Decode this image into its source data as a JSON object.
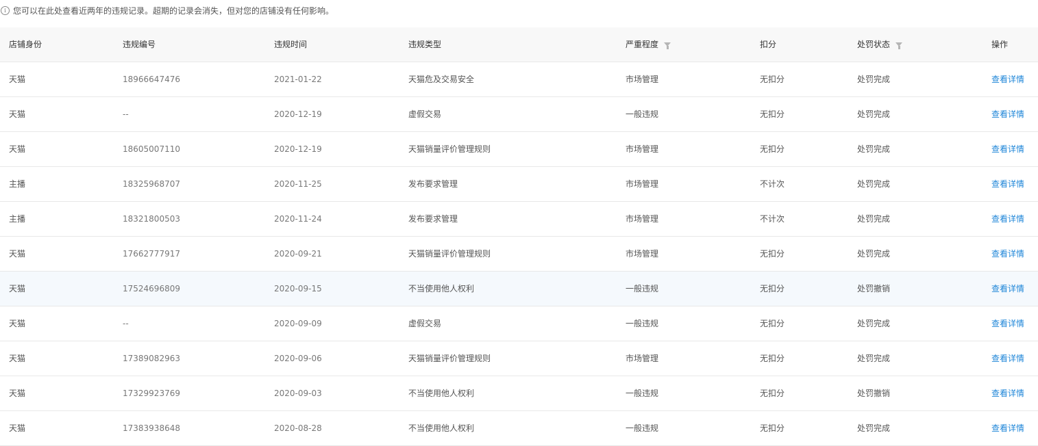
{
  "notice": {
    "icon": "info-icon",
    "icon_glyph": "i",
    "text": "您可以在此处查看近两年的违规记录。超期的记录会消失，但对您的店铺没有任何影响。"
  },
  "table": {
    "headers": [
      "店铺身份",
      "违规编号",
      "违规时间",
      "违规类型",
      "严重程度",
      "扣分",
      "处罚状态",
      "操作"
    ],
    "filterable_columns": [
      "严重程度",
      "处罚状态"
    ],
    "highlight_row_index": 6,
    "link_color": "#1f86d8",
    "rows": [
      {
        "identity": "天猫",
        "code": "18966647476",
        "time": "2021-01-22",
        "type": "天猫危及交易安全",
        "severity": "市场管理",
        "points": "无扣分",
        "status": "处罚完成",
        "action": "查看详情"
      },
      {
        "identity": "天猫",
        "code": "--",
        "time": "2020-12-19",
        "type": "虚假交易",
        "severity": "一般违规",
        "points": "无扣分",
        "status": "处罚完成",
        "action": "查看详情"
      },
      {
        "identity": "天猫",
        "code": "18605007110",
        "time": "2020-12-19",
        "type": "天猫销量评价管理规则",
        "severity": "市场管理",
        "points": "无扣分",
        "status": "处罚完成",
        "action": "查看详情"
      },
      {
        "identity": "主播",
        "code": "18325968707",
        "time": "2020-11-25",
        "type": "发布要求管理",
        "severity": "市场管理",
        "points": "不计次",
        "status": "处罚完成",
        "action": "查看详情"
      },
      {
        "identity": "主播",
        "code": "18321800503",
        "time": "2020-11-24",
        "type": "发布要求管理",
        "severity": "市场管理",
        "points": "不计次",
        "status": "处罚完成",
        "action": "查看详情"
      },
      {
        "identity": "天猫",
        "code": "17662777917",
        "time": "2020-09-21",
        "type": "天猫销量评价管理规则",
        "severity": "市场管理",
        "points": "无扣分",
        "status": "处罚完成",
        "action": "查看详情"
      },
      {
        "identity": "天猫",
        "code": "17524696809",
        "time": "2020-09-15",
        "type": "不当使用他人权利",
        "severity": "一般违规",
        "points": "无扣分",
        "status": "处罚撤销",
        "action": "查看详情"
      },
      {
        "identity": "天猫",
        "code": "--",
        "time": "2020-09-09",
        "type": "虚假交易",
        "severity": "一般违规",
        "points": "无扣分",
        "status": "处罚完成",
        "action": "查看详情"
      },
      {
        "identity": "天猫",
        "code": "17389082963",
        "time": "2020-09-06",
        "type": "天猫销量评价管理规则",
        "severity": "市场管理",
        "points": "无扣分",
        "status": "处罚完成",
        "action": "查看详情"
      },
      {
        "identity": "天猫",
        "code": "17329923769",
        "time": "2020-09-03",
        "type": "不当使用他人权利",
        "severity": "一般违规",
        "points": "无扣分",
        "status": "处罚撤销",
        "action": "查看详情"
      },
      {
        "identity": "天猫",
        "code": "17383938648",
        "time": "2020-08-28",
        "type": "不当使用他人权利",
        "severity": "一般违规",
        "points": "无扣分",
        "status": "处罚完成",
        "action": "查看详情"
      }
    ]
  }
}
